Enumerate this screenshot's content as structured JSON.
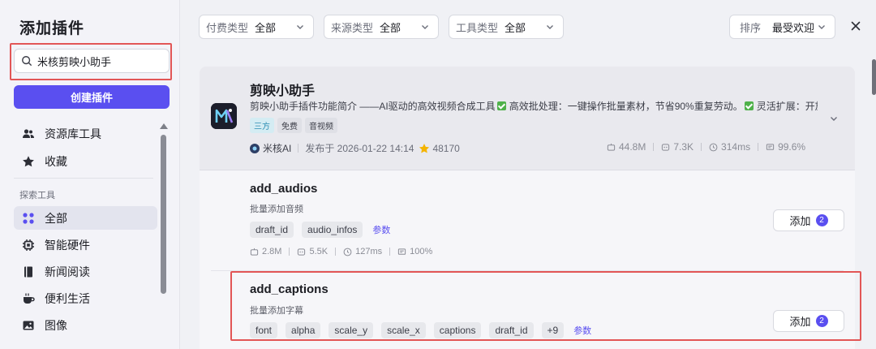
{
  "sidebar": {
    "title": "添加插件",
    "search": {
      "value": "米核剪映小助手",
      "placeholder": ""
    },
    "create_label": "创建插件",
    "items_top": [
      {
        "label": "资源库工具",
        "icon": "users-icon"
      },
      {
        "label": "收藏",
        "icon": "star-icon"
      }
    ],
    "section_label": "探索工具",
    "items": [
      {
        "label": "全部",
        "icon": "grid-icon",
        "active": true
      },
      {
        "label": "智能硬件",
        "icon": "chip-icon"
      },
      {
        "label": "新闻阅读",
        "icon": "book-icon"
      },
      {
        "label": "便利生活",
        "icon": "cup-icon"
      },
      {
        "label": "图像",
        "icon": "image-icon"
      }
    ]
  },
  "filters": [
    {
      "key": "付费类型",
      "value": "全部"
    },
    {
      "key": "来源类型",
      "value": "全部"
    },
    {
      "key": "工具类型",
      "value": "全部"
    }
  ],
  "sort": {
    "key": "排序",
    "value": "最受欢迎"
  },
  "plugin": {
    "title": "剪映小助手",
    "description_parts": [
      "剪映小助手插件功能简介 ——AI驱动的高效视频合成工具",
      "高效批处理：一键操作批量素材，节省90%重复劳动。",
      "灵活扩展：开放插…"
    ],
    "tags": [
      "三方",
      "免费",
      "音视频"
    ],
    "author": "米核AI",
    "published": "发布于 2026-01-22 14:14",
    "favorites": "48170",
    "stats": [
      "44.8M",
      "7.3K",
      "314ms",
      "99.6%"
    ]
  },
  "tools": [
    {
      "name": "add_audios",
      "desc": "批量添加音频",
      "params": [
        "draft_id",
        "audio_infos"
      ],
      "param_link": "参数",
      "stats": [
        "2.8M",
        "5.5K",
        "127ms",
        "100%"
      ],
      "add_label": "添加",
      "add_count": "2"
    },
    {
      "name": "add_captions",
      "desc": "批量添加字幕",
      "params": [
        "font",
        "alpha",
        "scale_y",
        "scale_x",
        "captions",
        "draft_id",
        "+9"
      ],
      "param_link": "参数",
      "add_label": "添加",
      "add_count": "2"
    }
  ],
  "colors": {
    "accent": "#5a4ff0",
    "highlight": "#e25656"
  }
}
